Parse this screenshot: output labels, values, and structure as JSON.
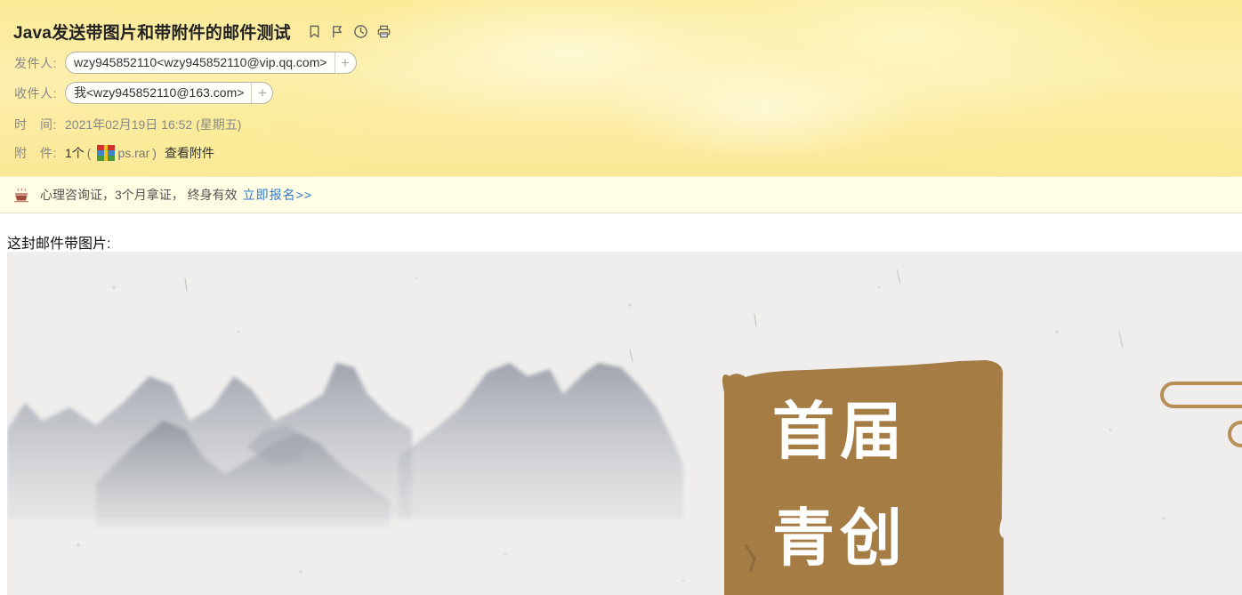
{
  "email": {
    "subject": "Java发送带图片和带附件的邮件测试",
    "sender_label": "发件人:",
    "sender": "wzy945852110<wzy945852110@vip.qq.com>",
    "recipient_label": "收件人:",
    "recipient": "我<wzy945852110@163.com>",
    "add_contact": "+",
    "time_label": "时　间:",
    "time": "2021年02月19日 16:52 (星期五)",
    "attachment_label": "附　件:",
    "attachment_count": "1个",
    "attachment_paren_open": "(",
    "attachment_name": "ps.rar",
    "attachment_paren_close": ")",
    "attachment_view": "查看附件"
  },
  "header_icons": [
    "bookmark-icon",
    "flag-icon",
    "clock-icon",
    "print-icon"
  ],
  "promo": {
    "icon": "cup-icon",
    "text": "心理咨询证，3个月拿证， 终身有效",
    "link": "立即报名>>"
  },
  "body": {
    "text": "这封邮件带图片:",
    "image": {
      "title_line1": "首届",
      "title_line2": "青创"
    }
  },
  "colors": {
    "header_bg": "#fbea96",
    "promo_bg": "#fffde3",
    "link": "#2a7ad2",
    "scroll_brown": "#a67c45"
  }
}
